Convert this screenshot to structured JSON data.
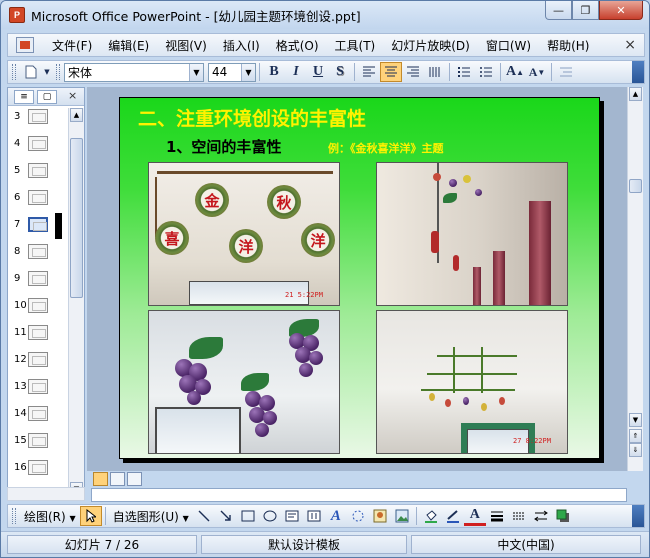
{
  "window": {
    "title": "Microsoft Office PowerPoint - [幼儿园主题环境创设.ppt]",
    "app_icon_text": "P",
    "minimize_label": "—",
    "restore_label": "❐",
    "close_label": "✕"
  },
  "menu": {
    "items": [
      "文件(F)",
      "编辑(E)",
      "视图(V)",
      "插入(I)",
      "格式(O)",
      "工具(T)",
      "幻灯片放映(D)",
      "窗口(W)",
      "帮助(H)"
    ],
    "close_label": "×"
  },
  "format_toolbar": {
    "font_name": "宋体",
    "font_size": "44",
    "bold_label": "B",
    "italic_label": "I",
    "underline_label": "U",
    "shadow_label": "S",
    "grow_label": "A",
    "shrink_label": "A"
  },
  "slide_pane": {
    "slide_numbers": [
      "3",
      "4",
      "5",
      "6",
      "7",
      "8",
      "9",
      "10",
      "11",
      "12",
      "13",
      "14",
      "15",
      "16"
    ],
    "selected_slide": "7",
    "close_label": "×"
  },
  "slide": {
    "title": "二、注重环境创设的丰富性",
    "subtitle": "1、空间的丰富性",
    "example": "例：《金秋喜洋洋》主题",
    "disc_chars": [
      "金",
      "秋",
      "喜",
      "洋",
      "洋"
    ],
    "photo_stamps": [
      "21 5:22PM",
      "27 8:22PM"
    ],
    "background_top": "#1ad71a",
    "title_color": "#fff200"
  },
  "draw_toolbar": {
    "draw_label": "绘图(R)",
    "autoshape_label": "自选图形(U)"
  },
  "status": {
    "slide_position": "幻灯片 7 / 26",
    "template": "默认设计模板",
    "language": "中文(中国)"
  }
}
